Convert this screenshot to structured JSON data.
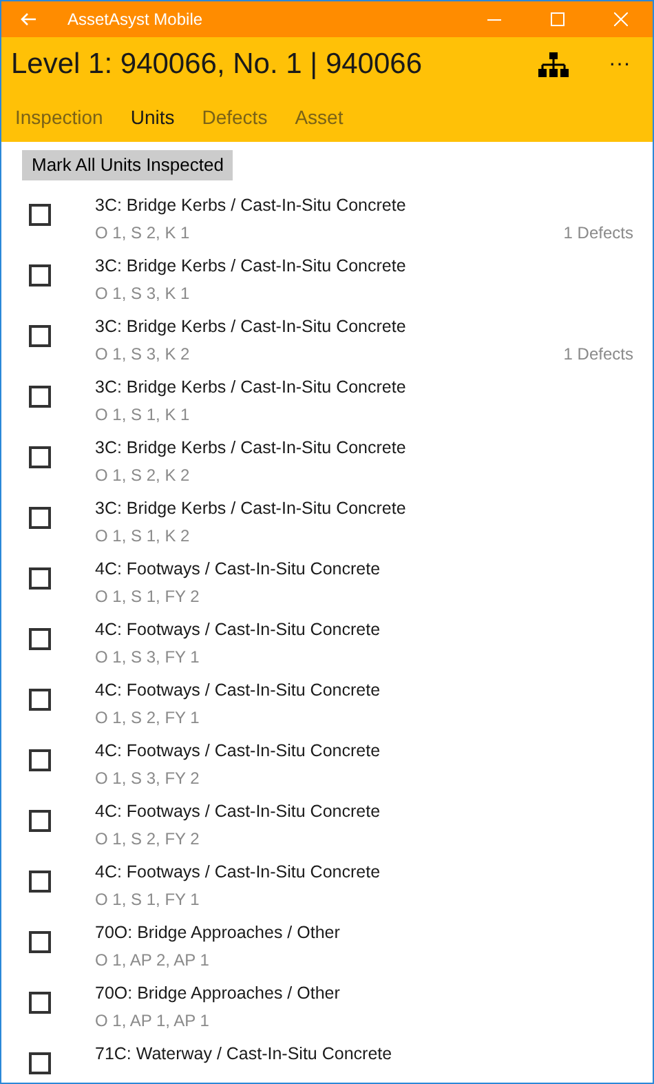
{
  "window": {
    "title": "AssetAsyst Mobile"
  },
  "header": {
    "title": "Level 1: 940066, No. 1 | 940066",
    "more": "···"
  },
  "tabs": [
    {
      "label": "Inspection",
      "selected": false
    },
    {
      "label": "Units",
      "selected": true
    },
    {
      "label": "Defects",
      "selected": false
    },
    {
      "label": "Asset",
      "selected": false
    }
  ],
  "mark_all_button": "Mark All Units Inspected",
  "units": [
    {
      "name": "3C: Bridge Kerbs / Cast-In-Situ Concrete",
      "location": "O 1, S 2, K 1",
      "defects": "1 Defects",
      "checked": false
    },
    {
      "name": "3C: Bridge Kerbs / Cast-In-Situ Concrete",
      "location": "O 1, S 3, K 1",
      "checked": false
    },
    {
      "name": "3C: Bridge Kerbs / Cast-In-Situ Concrete",
      "location": "O 1, S 3, K 2",
      "defects": "1 Defects",
      "checked": false
    },
    {
      "name": "3C: Bridge Kerbs / Cast-In-Situ Concrete",
      "location": "O 1, S 1, K 1",
      "checked": false
    },
    {
      "name": "3C: Bridge Kerbs / Cast-In-Situ Concrete",
      "location": "O 1, S 2, K 2",
      "checked": false
    },
    {
      "name": "3C: Bridge Kerbs / Cast-In-Situ Concrete",
      "location": "O 1, S 1, K 2",
      "checked": false
    },
    {
      "name": "4C: Footways / Cast-In-Situ Concrete",
      "location": "O 1, S 1, FY 2",
      "checked": false
    },
    {
      "name": "4C: Footways / Cast-In-Situ Concrete",
      "location": "O 1, S 3, FY 1",
      "checked": false
    },
    {
      "name": "4C: Footways / Cast-In-Situ Concrete",
      "location": "O 1, S 2, FY 1",
      "checked": false
    },
    {
      "name": "4C: Footways / Cast-In-Situ Concrete",
      "location": "O 1, S 3, FY 2",
      "checked": false
    },
    {
      "name": "4C: Footways / Cast-In-Situ Concrete",
      "location": "O 1, S 2, FY 2",
      "checked": false
    },
    {
      "name": "4C: Footways / Cast-In-Situ Concrete",
      "location": "O 1, S 1, FY 1",
      "checked": false
    },
    {
      "name": "70O: Bridge Approaches / Other",
      "location": "O 1, AP 2, AP 1",
      "checked": false
    },
    {
      "name": "70O: Bridge Approaches / Other",
      "location": "O 1, AP 1, AP 1",
      "checked": false
    },
    {
      "name": "71C: Waterway / Cast-In-Situ Concrete",
      "checked": false
    }
  ]
}
